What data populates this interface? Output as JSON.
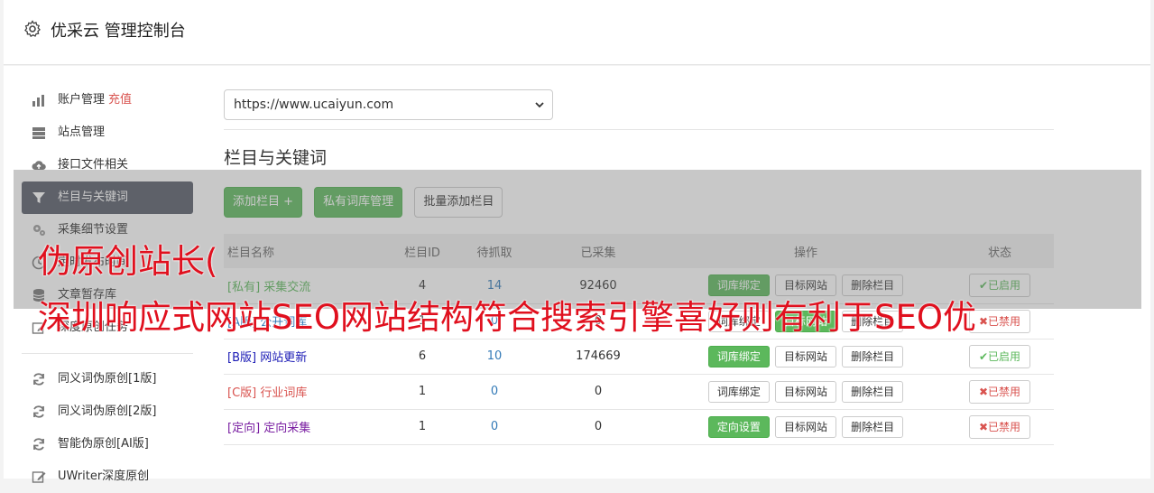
{
  "app": {
    "title": "优采云 管理控制台"
  },
  "sidebar": {
    "items": [
      {
        "label": "账户管理",
        "extra": "充值",
        "icon": "bar-chart-icon"
      },
      {
        "label": "站点管理",
        "icon": "server-icon"
      },
      {
        "label": "接口文件相关",
        "icon": "cloud-upload-icon"
      },
      {
        "label": "栏目与关键词",
        "icon": "filter-icon",
        "active": true
      },
      {
        "label": "采集细节设置",
        "icon": "cogs-icon"
      },
      {
        "label": "定时发布时间",
        "icon": "clock-icon"
      },
      {
        "label": "文章暂存库",
        "icon": "database-icon"
      },
      {
        "label": "深度原创任务",
        "icon": "edit-icon"
      }
    ],
    "tools": [
      {
        "label": "同义词伪原创[1版]",
        "icon": "refresh-icon"
      },
      {
        "label": "同义词伪原创[2版]",
        "icon": "refresh-icon"
      },
      {
        "label": "智能伪原创[AI版]",
        "icon": "refresh-icon"
      },
      {
        "label": "UWriter深度原创",
        "icon": "edit-icon"
      }
    ]
  },
  "content": {
    "site_select": "https://www.ucaiyun.com",
    "section_title": "栏目与关键词",
    "buttons": {
      "add": "添加栏目 +",
      "private_lib": "私有词库管理",
      "batch_add": "批量添加栏目"
    },
    "table": {
      "headers": {
        "name": "栏目名称",
        "id": "栏目ID",
        "pending": "待抓取",
        "collected": "已采集",
        "ops": "操作",
        "status": "状态"
      },
      "rows": [
        {
          "tag": "[私有]",
          "name": "采集交流",
          "id": "4",
          "pending": "14",
          "collected": "92460",
          "op1": "词库绑定",
          "op1_green": true,
          "op2": "目标网站",
          "op3": "删除栏目",
          "status": "✔已启用",
          "enabled": true,
          "tag_class": "tag-private"
        },
        {
          "tag": "[A版]",
          "name": "公开词库",
          "id": "1",
          "pending": "0",
          "collected": "0",
          "op1": "词库绑定",
          "op1_green": false,
          "op2": "目标网站",
          "op2_green": true,
          "op3": "删除栏目",
          "status": "✖已禁用",
          "enabled": false,
          "tag_class": "tag-a"
        },
        {
          "tag": "[B版]",
          "name": "网站更新",
          "id": "6",
          "pending": "10",
          "collected": "174669",
          "op1": "词库绑定",
          "op1_green": true,
          "op2": "目标网站",
          "op3": "删除栏目",
          "status": "✔已启用",
          "enabled": true,
          "tag_class": "tag-b"
        },
        {
          "tag": "[C版]",
          "name": "行业词库",
          "id": "1",
          "pending": "0",
          "collected": "0",
          "op1": "词库绑定",
          "op1_green": false,
          "op2": "目标网站",
          "op3": "删除栏目",
          "status": "✖已禁用",
          "enabled": false,
          "tag_class": "tag-c"
        },
        {
          "tag": "[定向]",
          "name": "定向采集",
          "id": "1",
          "pending": "0",
          "collected": "0",
          "op1": "定向设置",
          "op1_green": true,
          "op2": "目标网站",
          "op3": "删除栏目",
          "status": "✖已禁用",
          "enabled": false,
          "tag_class": "tag-d"
        }
      ]
    }
  },
  "overlay": {
    "line1": "伪原创站长(",
    "line2": "深圳响应式网站SEO网站结构符合搜索引擎喜好则有利于SEO优"
  },
  "colors": {
    "green": "#5cb85c",
    "red": "#d9534f",
    "active_sidebar": "#555a66",
    "overlay_text": "#e0101e"
  }
}
